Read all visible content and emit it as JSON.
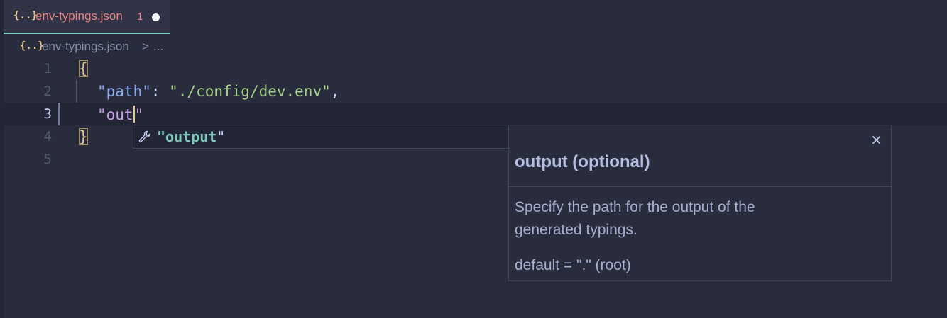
{
  "tab": {
    "icon": "{..}",
    "icon_name": "json-braces-icon",
    "title": "env-typings.json",
    "problem_count": "1"
  },
  "breadcrumb": {
    "icon": "{..}",
    "file": "env-typings.json",
    "separator": ">",
    "more": "..."
  },
  "editor": {
    "line_numbers": [
      "1",
      "2",
      "3",
      "4",
      "5"
    ],
    "current_line": "3",
    "line1": {
      "open_brace": "{"
    },
    "line2": {
      "key": "\"path\"",
      "colon": ": ",
      "value": "\"./config/dev.env\"",
      "comma": ","
    },
    "line3": {
      "typed": "\"out",
      "closing_quote": "\""
    },
    "line4": {
      "close_brace": "}"
    }
  },
  "suggest": {
    "icon_name": "wrench-icon",
    "label_match": "\"output",
    "label_rest": "\""
  },
  "details": {
    "title": "output (optional)",
    "description": "Specify the path for the output of the generated typings.",
    "default": "default = \".\" (root)",
    "close": "×"
  },
  "colors": {
    "background": "#292c3c",
    "accent": "#81c8be",
    "tab_title": "#e78284",
    "json_icon": "#e5c890",
    "string": "#a6d189",
    "key": "#8caaee"
  }
}
